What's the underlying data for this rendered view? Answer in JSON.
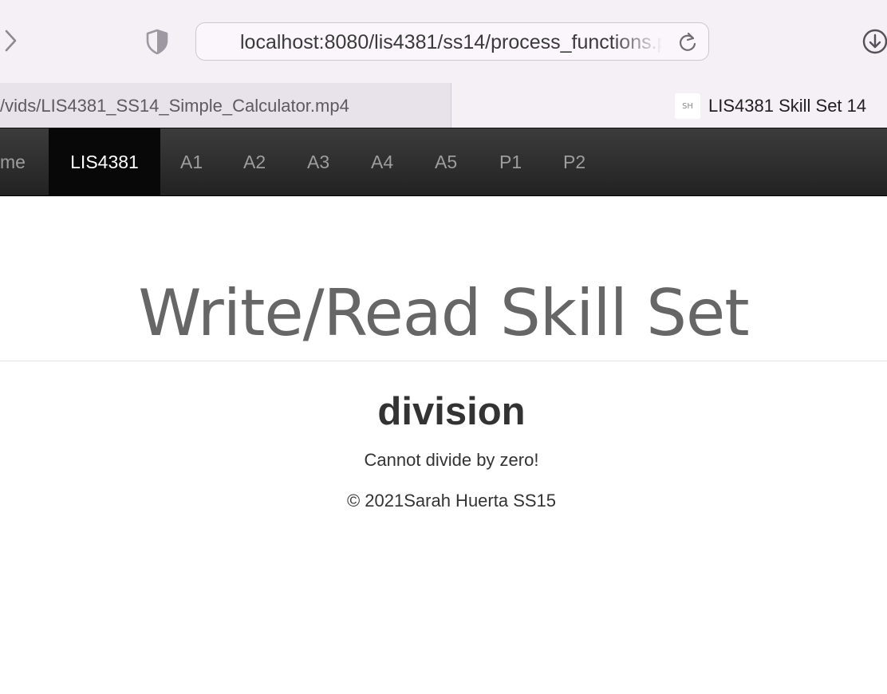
{
  "browser": {
    "url": "localhost:8080/lis4381/ss14/process_functions.php",
    "tabs": [
      {
        "title": "/vids/LIS4381_SS14_Simple_Calculator.mp4",
        "active": true
      },
      {
        "title": "LIS4381 Skill Set 14",
        "active": false,
        "favicon_text": "SH"
      }
    ],
    "icons": {
      "forward": "chevron-right-icon",
      "privacy": "shield-icon",
      "reload": "reload-icon",
      "downloads": "download-icon"
    }
  },
  "navbar": {
    "items": [
      {
        "label": "me"
      },
      {
        "label": "LIS4381",
        "active": true
      },
      {
        "label": "A1"
      },
      {
        "label": "A2"
      },
      {
        "label": "A3"
      },
      {
        "label": "A4"
      },
      {
        "label": "A5"
      },
      {
        "label": "P1"
      },
      {
        "label": "P2"
      }
    ],
    "colors": {
      "background": "#222222",
      "active_background": "#080808",
      "text": "#9d9d9d",
      "active_text": "#ffffff"
    }
  },
  "page": {
    "title": "Write/Read Skill Set",
    "operation": "division",
    "result": "Cannot divide by zero!",
    "footer": "© 2021Sarah Huerta SS15"
  }
}
